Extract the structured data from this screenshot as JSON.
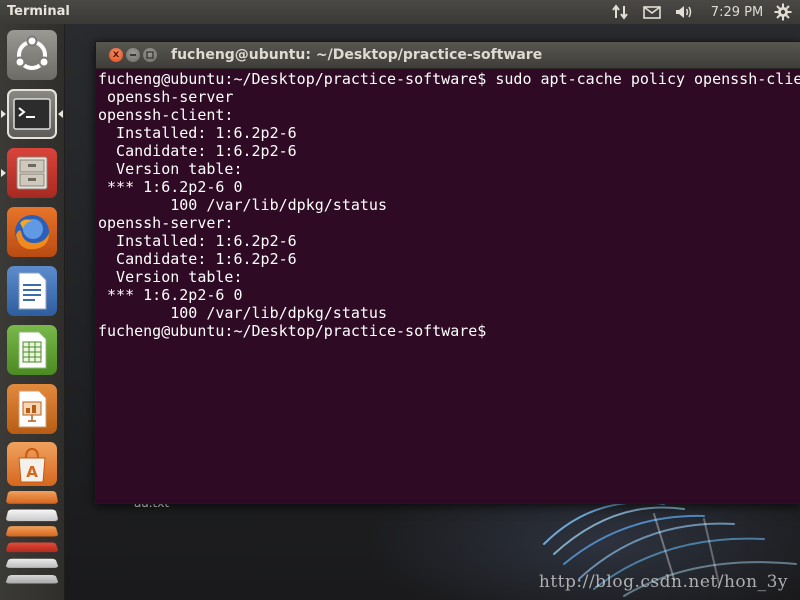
{
  "panel": {
    "app_title": "Terminal",
    "clock": "7:29 PM",
    "icons": [
      "network-icon",
      "mail-icon",
      "volume-icon",
      "session-gear-icon"
    ]
  },
  "launcher": {
    "items": [
      {
        "name": "dash-home",
        "icon": "ubuntu-logo-icon"
      },
      {
        "name": "terminal",
        "icon": "terminal-icon",
        "active": true
      },
      {
        "name": "files",
        "icon": "file-cabinet-icon"
      },
      {
        "name": "firefox",
        "icon": "firefox-icon"
      },
      {
        "name": "libreoffice-writer",
        "icon": "writer-document-icon"
      },
      {
        "name": "libreoffice-calc",
        "icon": "calc-spreadsheet-icon"
      },
      {
        "name": "libreoffice-impress",
        "icon": "impress-presentation-icon"
      },
      {
        "name": "ubuntu-software-center",
        "icon": "shopping-bag-icon"
      }
    ]
  },
  "window": {
    "title": "fucheng@ubuntu: ~/Desktop/practice-software",
    "close_glyph": "x"
  },
  "terminal": {
    "lines": [
      "fucheng@ubuntu:~/Desktop/practice-software$ sudo apt-cache policy openssh-clie",
      " openssh-server",
      "openssh-client:",
      "  Installed: 1:6.2p2-6",
      "  Candidate: 1:6.2p2-6",
      "  Version table:",
      " *** 1:6.2p2-6 0",
      "        100 /var/lib/dpkg/status",
      "openssh-server:",
      "  Installed: 1:6.2p2-6",
      "  Candidate: 1:6.2p2-6",
      "  Version table:",
      " *** 1:6.2p2-6 0",
      "        100 /var/lib/dpkg/status",
      "fucheng@ubuntu:~/Desktop/practice-software$"
    ]
  },
  "desktop": {
    "file_label": "aa.txt",
    "watermark": "http://blog.csdn.net/hon_3y"
  },
  "colors": {
    "terminal_bg": "#2f0a24",
    "terminal_fg": "#ffffff",
    "close_button": "#df4b16",
    "panel_bg": "#3a3935"
  }
}
